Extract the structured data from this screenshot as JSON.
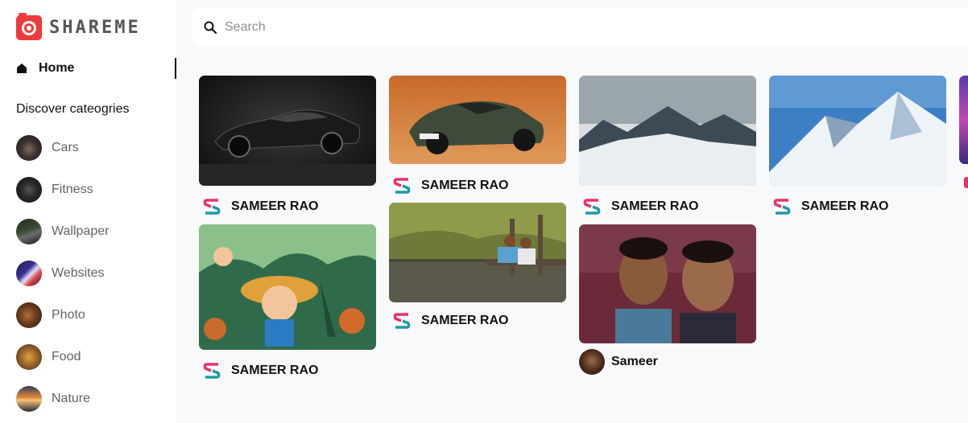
{
  "app": {
    "logo_text": "SHAREME"
  },
  "sidebar": {
    "home_label": "Home",
    "discover_title": "Discover cateogries",
    "categories": [
      {
        "label": "Cars"
      },
      {
        "label": "Fitness"
      },
      {
        "label": "Wallpaper"
      },
      {
        "label": "Websites"
      },
      {
        "label": "Photo"
      },
      {
        "label": "Food"
      },
      {
        "label": "Nature"
      }
    ]
  },
  "search": {
    "placeholder": "Search",
    "value": ""
  },
  "pins": [
    {
      "image": "black muscle car",
      "user": "SAMEER RAO"
    },
    {
      "image": "anime boy in straw hat",
      "user": "SAMEER RAO"
    },
    {
      "image": "porsche drifting in desert",
      "user": "SAMEER RAO"
    },
    {
      "image": "two people sitting by water",
      "user": "SAMEER RAO"
    },
    {
      "image": "snowy mountains",
      "user": "SAMEER RAO"
    },
    {
      "image": "two men selfie",
      "user": "Sameer"
    },
    {
      "image": "snow covered peak",
      "user": "SAMEER RAO"
    },
    {
      "image": "purple abstract",
      "user": ""
    }
  ],
  "colors": {
    "brand": "#ef3b3b",
    "sidebar_bg": "#ffffff",
    "page_bg": "#f8f9fb"
  }
}
